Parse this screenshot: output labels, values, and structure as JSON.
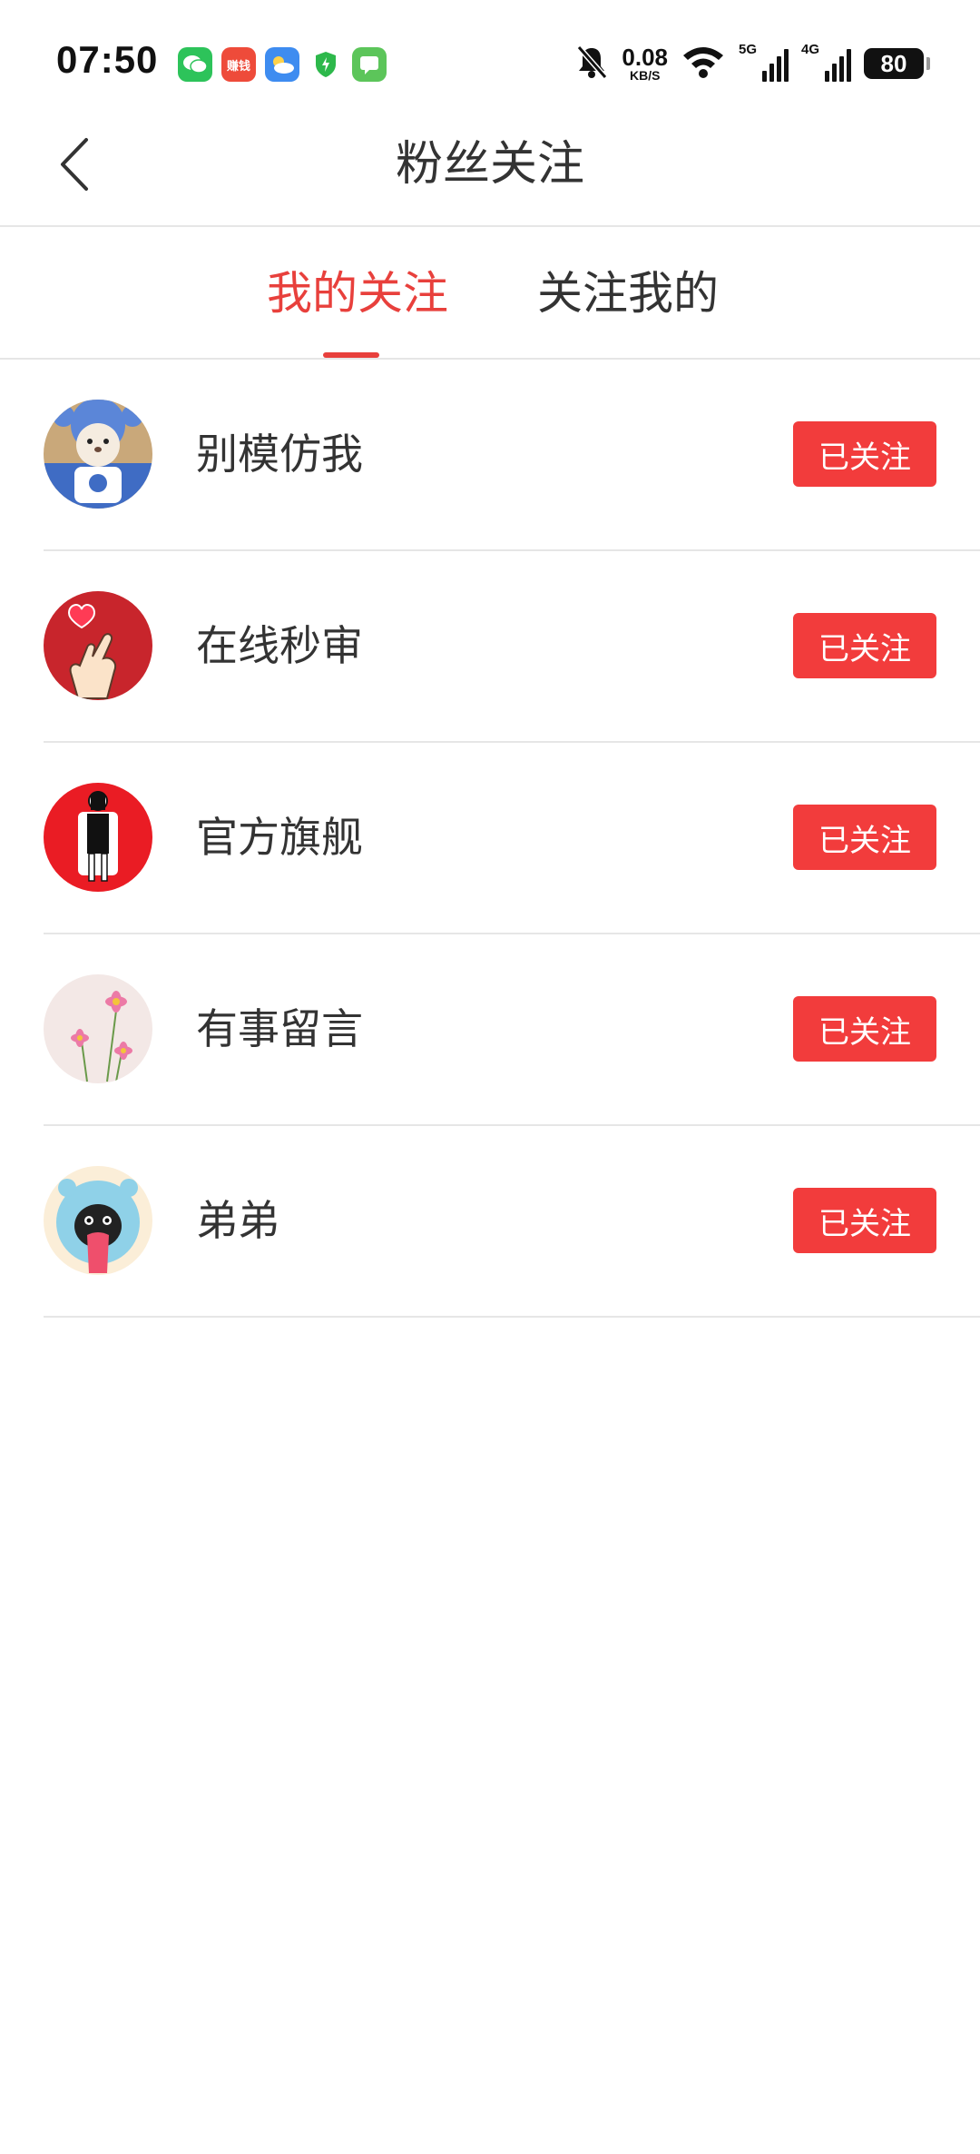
{
  "status_bar": {
    "time": "07:50",
    "net_speed_value": "0.08",
    "net_speed_unit": "KB/S",
    "signal_1_label": "5G",
    "signal_2_label": "4G",
    "battery": "80",
    "app_icons": [
      "wechat-icon",
      "earn-money-icon",
      "weather-icon",
      "security-shield-icon",
      "message-icon"
    ],
    "earn_icon_text": "赚钱"
  },
  "header": {
    "title": "粉丝关注"
  },
  "tabs": [
    {
      "label": "我的关注",
      "active": true
    },
    {
      "label": "关注我的",
      "active": false
    }
  ],
  "follow_list": [
    {
      "name": "别模仿我",
      "button": "已关注",
      "avatar": "teddy-bear-avatar"
    },
    {
      "name": "在线秒审",
      "button": "已关注",
      "avatar": "heart-finger-avatar"
    },
    {
      "name": "官方旗舰",
      "button": "已关注",
      "avatar": "person-red-avatar"
    },
    {
      "name": "有事留言",
      "button": "已关注",
      "avatar": "flowers-avatar"
    },
    {
      "name": "弟弟",
      "button": "已关注",
      "avatar": "penguin-hat-avatar"
    }
  ],
  "colors": {
    "accent": "#e8403c",
    "button": "#f23c3c",
    "divider": "#e6e6e6"
  }
}
